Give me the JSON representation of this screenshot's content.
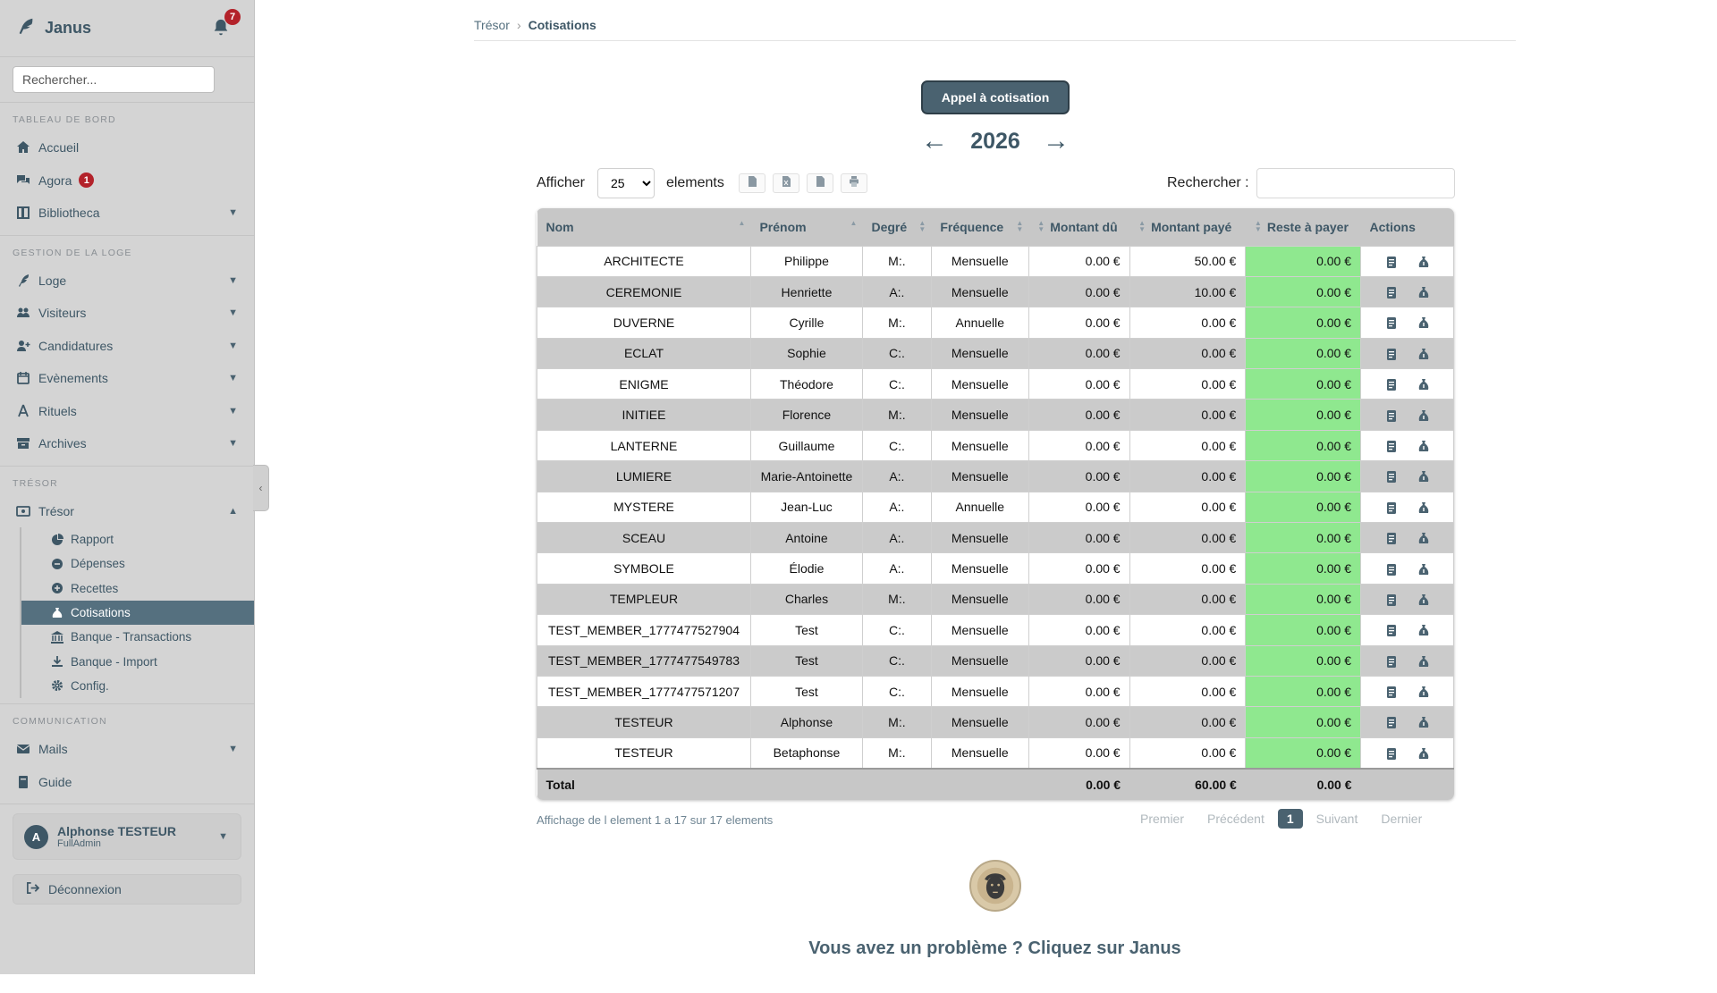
{
  "app": {
    "name": "Janus",
    "notifications": "7"
  },
  "sidebar": {
    "search_placeholder": "Rechercher...",
    "sections": {
      "dashboard": "TABLEAU DE BORD",
      "lodge": "GESTION DE LA LOGE",
      "treasury": "TRÉSOR",
      "communication": "COMMUNICATION"
    },
    "items": {
      "accueil": "Accueil",
      "agora": "Agora",
      "agora_badge": "1",
      "bibliotheca": "Bibliotheca",
      "loge": "Loge",
      "visiteurs": "Visiteurs",
      "candidatures": "Candidatures",
      "evenements": "Evènements",
      "rituels": "Rituels",
      "archives": "Archives",
      "tresor": "Trésor",
      "mails": "Mails",
      "guide": "Guide"
    },
    "tresor_sub": {
      "rapport": "Rapport",
      "depenses": "Dépenses",
      "recettes": "Recettes",
      "cotisations": "Cotisations",
      "banque_transactions": "Banque - Transactions",
      "banque_import": "Banque - Import",
      "config": "Config."
    },
    "user": {
      "initial": "A",
      "name": "Alphonse TESTEUR",
      "role": "FullAdmin"
    },
    "logout": "Déconnexion"
  },
  "breadcrumb": {
    "parent": "Trésor",
    "current": "Cotisations"
  },
  "appel_button": "Appel à cotisation",
  "year": "2026",
  "table_tools": {
    "show_label": "Afficher",
    "page_size": "25",
    "elements_label": "elements",
    "search_label": "Rechercher :"
  },
  "columns": [
    "Nom",
    "Prénom",
    "Degré",
    "Fréquence",
    "Montant dû",
    "Montant payé",
    "Reste à payer",
    "Actions"
  ],
  "rows": [
    [
      "ARCHITECTE",
      "Philippe",
      "M:.",
      "Mensuelle",
      "0.00 €",
      "50.00 €",
      "0.00 €"
    ],
    [
      "CEREMONIE",
      "Henriette",
      "A:.",
      "Mensuelle",
      "0.00 €",
      "10.00 €",
      "0.00 €"
    ],
    [
      "DUVERNE",
      "Cyrille",
      "M:.",
      "Annuelle",
      "0.00 €",
      "0.00 €",
      "0.00 €"
    ],
    [
      "ECLAT",
      "Sophie",
      "C:.",
      "Mensuelle",
      "0.00 €",
      "0.00 €",
      "0.00 €"
    ],
    [
      "ENIGME",
      "Théodore",
      "C:.",
      "Mensuelle",
      "0.00 €",
      "0.00 €",
      "0.00 €"
    ],
    [
      "INITIEE",
      "Florence",
      "M:.",
      "Mensuelle",
      "0.00 €",
      "0.00 €",
      "0.00 €"
    ],
    [
      "LANTERNE",
      "Guillaume",
      "C:.",
      "Mensuelle",
      "0.00 €",
      "0.00 €",
      "0.00 €"
    ],
    [
      "LUMIERE",
      "Marie-Antoinette",
      "A:.",
      "Mensuelle",
      "0.00 €",
      "0.00 €",
      "0.00 €"
    ],
    [
      "MYSTERE",
      "Jean-Luc",
      "A:.",
      "Annuelle",
      "0.00 €",
      "0.00 €",
      "0.00 €"
    ],
    [
      "SCEAU",
      "Antoine",
      "A:.",
      "Mensuelle",
      "0.00 €",
      "0.00 €",
      "0.00 €"
    ],
    [
      "SYMBOLE",
      "Élodie",
      "A:.",
      "Mensuelle",
      "0.00 €",
      "0.00 €",
      "0.00 €"
    ],
    [
      "TEMPLEUR",
      "Charles",
      "M:.",
      "Mensuelle",
      "0.00 €",
      "0.00 €",
      "0.00 €"
    ],
    [
      "TEST_MEMBER_1777477527904",
      "Test",
      "C:.",
      "Mensuelle",
      "0.00 €",
      "0.00 €",
      "0.00 €"
    ],
    [
      "TEST_MEMBER_1777477549783",
      "Test",
      "C:.",
      "Mensuelle",
      "0.00 €",
      "0.00 €",
      "0.00 €"
    ],
    [
      "TEST_MEMBER_1777477571207",
      "Test",
      "C:.",
      "Mensuelle",
      "0.00 €",
      "0.00 €",
      "0.00 €"
    ],
    [
      "TESTEUR",
      "Alphonse",
      "M:.",
      "Mensuelle",
      "0.00 €",
      "0.00 €",
      "0.00 €"
    ],
    [
      "TESTEUR",
      "Betaphonse",
      "M:.",
      "Mensuelle",
      "0.00 €",
      "0.00 €",
      "0.00 €"
    ]
  ],
  "totals": {
    "label": "Total",
    "montant_du": "0.00 €",
    "montant_paye": "60.00 €",
    "reste": "0.00 €"
  },
  "table_info": "Affichage de l element 1 a 17 sur 17 elements",
  "pager": {
    "first": "Premier",
    "prev": "Précédent",
    "current": "1",
    "next": "Suivant",
    "last": "Dernier"
  },
  "help_text": "Vous avez un problème ? Cliquez sur Janus",
  "colors": {
    "accent": "#4a6270",
    "sidebar_bg": "#d4d4d4",
    "paid_cell": "#8fe88f",
    "badge": "#b3222a"
  }
}
